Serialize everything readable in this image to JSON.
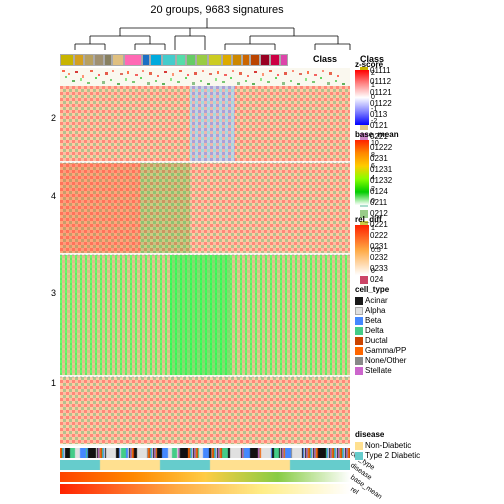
{
  "title": "20 groups, 9683 signatures",
  "legend": {
    "class_label": "Class",
    "zscore": {
      "title": "z-score",
      "values": [
        "2",
        "1",
        "0",
        "-1",
        "-2"
      ]
    },
    "base_mean": {
      "title": "base_mean",
      "values": [
        "10",
        "8",
        "6",
        "4",
        "2",
        "0"
      ]
    },
    "rel_diff": {
      "title": "rel_diff",
      "values": [
        "1",
        "0.5",
        "0"
      ]
    },
    "class_items": [
      {
        "label": "01111",
        "color": "#c8b400"
      },
      {
        "label": "01112",
        "color": "#d4a000"
      },
      {
        "label": "01121",
        "color": "#b8a060"
      },
      {
        "label": "01122",
        "color": "#b09070"
      },
      {
        "label": "0113",
        "color": "#908060"
      },
      {
        "label": "0121",
        "color": "#e0c080"
      },
      {
        "label": "0221",
        "color": "#c0c0c0"
      },
      {
        "label": "0222",
        "color": "#d0b090"
      },
      {
        "label": "01222",
        "color": "#c8a878"
      },
      {
        "label": "0231",
        "color": "#e8d8c0"
      },
      {
        "label": "01231",
        "color": "#f0e0b0"
      },
      {
        "label": "01232",
        "color": "#e8d0a0"
      },
      {
        "label": "0124",
        "color": "#f4e8c0"
      },
      {
        "label": "0211",
        "color": "#3050a0"
      },
      {
        "label": "0212",
        "color": "#6080c0"
      },
      {
        "label": "0221",
        "color": "#8090d0"
      },
      {
        "label": "0222",
        "color": "#a0b0e0"
      },
      {
        "label": "0231",
        "color": "#c0c8f0"
      },
      {
        "label": "0232",
        "color": "#b0c0e8"
      },
      {
        "label": "0233",
        "color": "#90a8d8"
      },
      {
        "label": "024",
        "color": "#80a0c8"
      }
    ],
    "cell_type_title": "cell_type",
    "cell_types": [
      {
        "label": "Acinar",
        "color": "#1a1a1a"
      },
      {
        "label": "Alpha",
        "color": "#e8e8e8"
      },
      {
        "label": "Beta",
        "color": "#3399ff"
      },
      {
        "label": "Delta",
        "color": "#00cc44"
      },
      {
        "label": "Ductal",
        "color": "#cc3300"
      },
      {
        "label": "Gamma/PP",
        "color": "#ff6600"
      },
      {
        "label": "None/Other",
        "color": "#888888"
      },
      {
        "label": "Stellate",
        "color": "#cc66cc"
      }
    ],
    "disease_title": "disease",
    "diseases": [
      {
        "label": "Non-Diabetic",
        "color": "#ffe090"
      },
      {
        "label": "Type 2 Diabetic",
        "color": "#66cccc"
      }
    ]
  },
  "row_labels": [
    {
      "label": "2",
      "top_pct": 20
    },
    {
      "label": "4",
      "top_pct": 38
    },
    {
      "label": "3",
      "top_pct": 62
    },
    {
      "label": "1",
      "top_pct": 84
    }
  ],
  "bottom_strip_labels": [
    "cell_type",
    "disease",
    "base_mean",
    "rel"
  ],
  "class_top_label": "Class"
}
